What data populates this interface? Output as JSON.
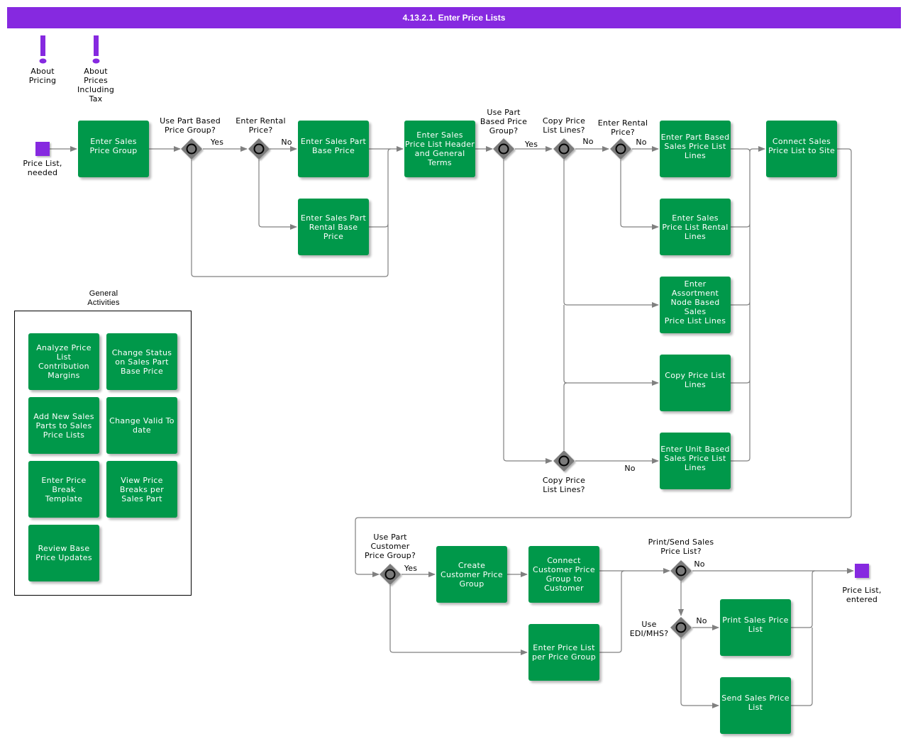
{
  "title": "4.13.2.1. Enter Price Lists",
  "colors": {
    "header": "#8629e0",
    "task": "#00984a",
    "gateway": "#7a7a7a",
    "event": "#8629e0",
    "wire": "#808080"
  },
  "notes": [
    {
      "icon": "exclamation-icon",
      "label": "About\nPricing"
    },
    {
      "icon": "exclamation-icon",
      "label": "About\nPrices\nIncluding\nTax"
    }
  ],
  "events": {
    "start": {
      "label": "Price List,\nneeded"
    },
    "end": {
      "label": "Price List,\nentered"
    }
  },
  "tasks": {
    "enter_sales_price_group": "Enter Sales\nPrice Group",
    "enter_sales_part_base_price": "Enter Sales Part\nBase Price",
    "enter_sales_part_rental_base_price": "Enter Sales Part\nRental Base\nPrice",
    "enter_price_list_header": "Enter Sales\nPrice List Header\nand General\nTerms",
    "enter_part_based_lines": "Enter Part Based\nSales Price List\nLines",
    "enter_rental_lines": "Enter Sales\nPrice List Rental\nLines",
    "enter_assortment_lines": "Enter Assortment\nNode Based Sales\nPrice List Lines",
    "copy_price_list_lines": "Copy Price List\nLines",
    "enter_unit_based_lines": "Enter Unit Based\nSales Price List\nLines",
    "connect_price_list_to_site": "Connect Sales\nPrice List to Site",
    "create_customer_price_group": "Create\nCustomer Price\nGroup",
    "connect_customer_price_group": "Connect\nCustomer Price\nGroup to\nCustomer",
    "enter_price_list_per_group": "Enter Price List\nper Price Group",
    "print_sales_price_list": "Print Sales Price\nList",
    "send_sales_price_list": "Send Sales Price\nList"
  },
  "gateways": {
    "g1": "Use Part Based\nPrice Group?",
    "g2": "Enter Rental\nPrice?",
    "g3": "Use Part\nBased Price\nGroup?",
    "g4": "Copy Price\nList Lines?",
    "g5": "Enter Rental\nPrice?",
    "g6": "Copy Price\nList Lines?",
    "g7": "Use Part\nCustomer\nPrice Group?",
    "g8": "Print/Send Sales\nPrice List?",
    "g9": "Use\nEDI/MHS?"
  },
  "flow_labels": {
    "g1_yes": "Yes",
    "g2_no": "No",
    "g3_yes": "Yes",
    "g4_no": "No",
    "g5_no": "No",
    "g6_no": "No",
    "g7_yes": "Yes",
    "g8_no": "No",
    "g9_no": "No"
  },
  "general_activities": {
    "title": "General\nActivities",
    "items": [
      "Analyze Price List\nContribution\nMargins",
      "Change Status\non Sales Part\nBase Price",
      "Add New Sales\nParts to Sales\nPrice Lists",
      "Change Valid To\ndate",
      "Enter Price Break\nTemplate",
      "View Price\nBreaks per\nSales Part",
      "Review Base\nPrice Updates"
    ]
  }
}
